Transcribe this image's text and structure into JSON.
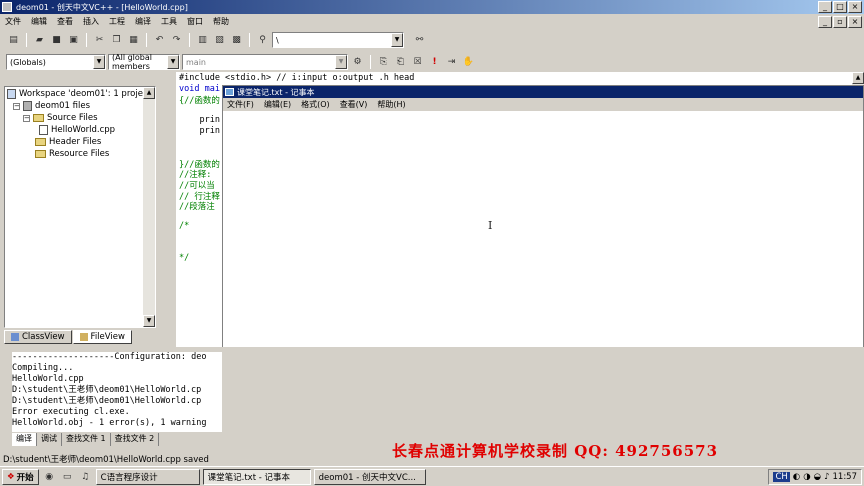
{
  "window": {
    "title": "deom01 - 创天中文VC++ - [HelloWorld.cpp]"
  },
  "menu": [
    "文件",
    "编辑",
    "查看",
    "插入",
    "工程",
    "编译",
    "工具",
    "窗口",
    "帮助"
  ],
  "toolbar": {
    "find_value": "\\"
  },
  "wizardbar": {
    "scope": "(Globals)",
    "members": "(All global members",
    "function": "main"
  },
  "workspace": {
    "root": "Workspace 'deom01': 1 proje",
    "project": "deom01 files",
    "source_folder": "Source Files",
    "source_file": "HelloWorld.cpp",
    "header_folder": "Header Files",
    "resource_folder": "Resource Files",
    "tab_classview": "ClassView",
    "tab_fileview": "FileView"
  },
  "code_lines": [
    {
      "text": "#include <stdio.h> // i:input o:output .h head",
      "cls": ""
    },
    {
      "text": "void mai",
      "cls": "kw"
    },
    {
      "text": "{//函数的",
      "cls": "cm"
    },
    {
      "text": "",
      "cls": ""
    },
    {
      "text": "    prin",
      "cls": ""
    },
    {
      "text": "    prin",
      "cls": ""
    },
    {
      "text": "",
      "cls": ""
    },
    {
      "text": "",
      "cls": ""
    },
    {
      "text": "}//函数的",
      "cls": "cm"
    },
    {
      "text": "//注释:",
      "cls": "cm"
    },
    {
      "text": "//可以当",
      "cls": "cm"
    },
    {
      "text": "// 行注释",
      "cls": "cm"
    },
    {
      "text": "//段落注",
      "cls": "cm"
    },
    {
      "text": "",
      "cls": ""
    },
    {
      "text": "/*",
      "cls": "cm"
    },
    {
      "text": "",
      "cls": ""
    },
    {
      "text": "",
      "cls": ""
    },
    {
      "text": "*/",
      "cls": "cm"
    }
  ],
  "notepad": {
    "title": "课堂笔记.txt - 记事本",
    "menu": [
      "文件(F)",
      "编辑(E)",
      "格式(O)",
      "查看(V)",
      "帮助(H)"
    ]
  },
  "output": {
    "lines": [
      "--------------------Configuration: deo",
      "Compiling...",
      "HelloWorld.cpp",
      "D:\\student\\王老师\\deom01\\HelloWorld.cp",
      "D:\\student\\王老师\\deom01\\HelloWorld.cp",
      "Error executing cl.exe.",
      "",
      "HelloWorld.obj - 1 error(s), 1 warning"
    ],
    "tabs": [
      "编译",
      "调试",
      "查找文件 1",
      "查找文件 2"
    ]
  },
  "status": {
    "text": "D:\\student\\王老师\\deom01\\HelloWorld.cpp saved"
  },
  "watermark": "长春点通计算机学校录制  QQ: 492756573",
  "taskbar": {
    "start": "开始",
    "tasks": [
      "C语言程序设计",
      "课堂笔记.txt - 记事本",
      "deom01 - 创天中文VC..."
    ],
    "lang": "CH",
    "clock": "11:57"
  }
}
